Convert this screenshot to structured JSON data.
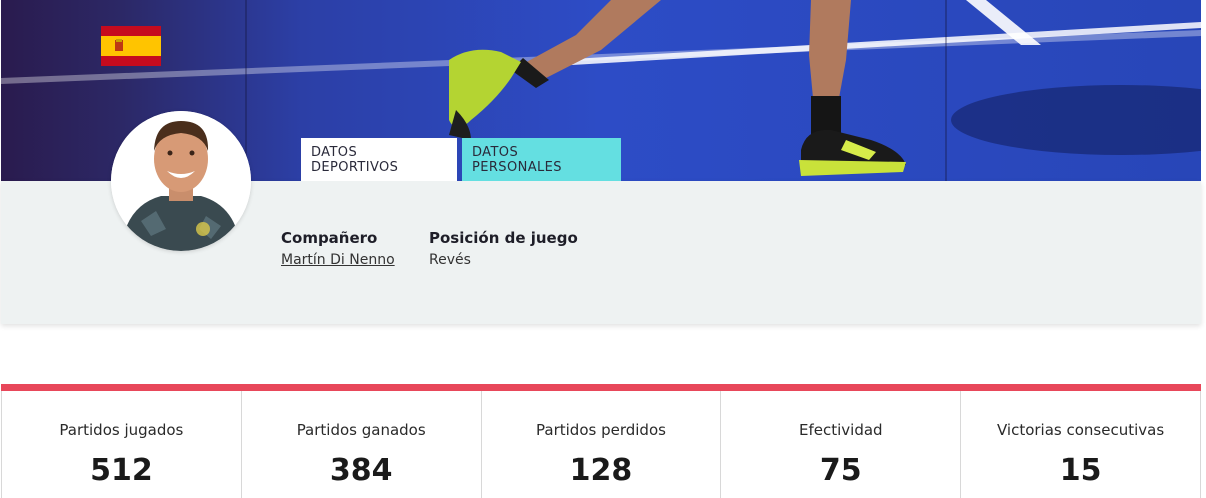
{
  "hero": {
    "flag_icon": "spain-flag-icon",
    "colors": {
      "flag_red": "#c60b1e",
      "flag_yellow": "#ffc400"
    }
  },
  "tabs": [
    {
      "label": "DATOS DEPORTIVOS",
      "active": true
    },
    {
      "label": "DATOS PERSONALES",
      "active": false
    }
  ],
  "profile": {
    "partner_label": "Compañero",
    "partner_value": "Martín Di Nenno",
    "position_label": "Posición de juego",
    "position_value": "Revés"
  },
  "stats": [
    {
      "label": "Partidos jugados",
      "value": "512"
    },
    {
      "label": "Partidos ganados",
      "value": "384"
    },
    {
      "label": "Partidos perdidos",
      "value": "128"
    },
    {
      "label": "Efectividad",
      "value": "75"
    },
    {
      "label": "Victorias consecutivas",
      "value": "15"
    }
  ],
  "colors": {
    "accent_bar": "#e8475a",
    "tab_active_bg": "#ffffff",
    "tab_inactive_bg": "#64dfe1",
    "info_band_bg": "#eef2f2"
  }
}
